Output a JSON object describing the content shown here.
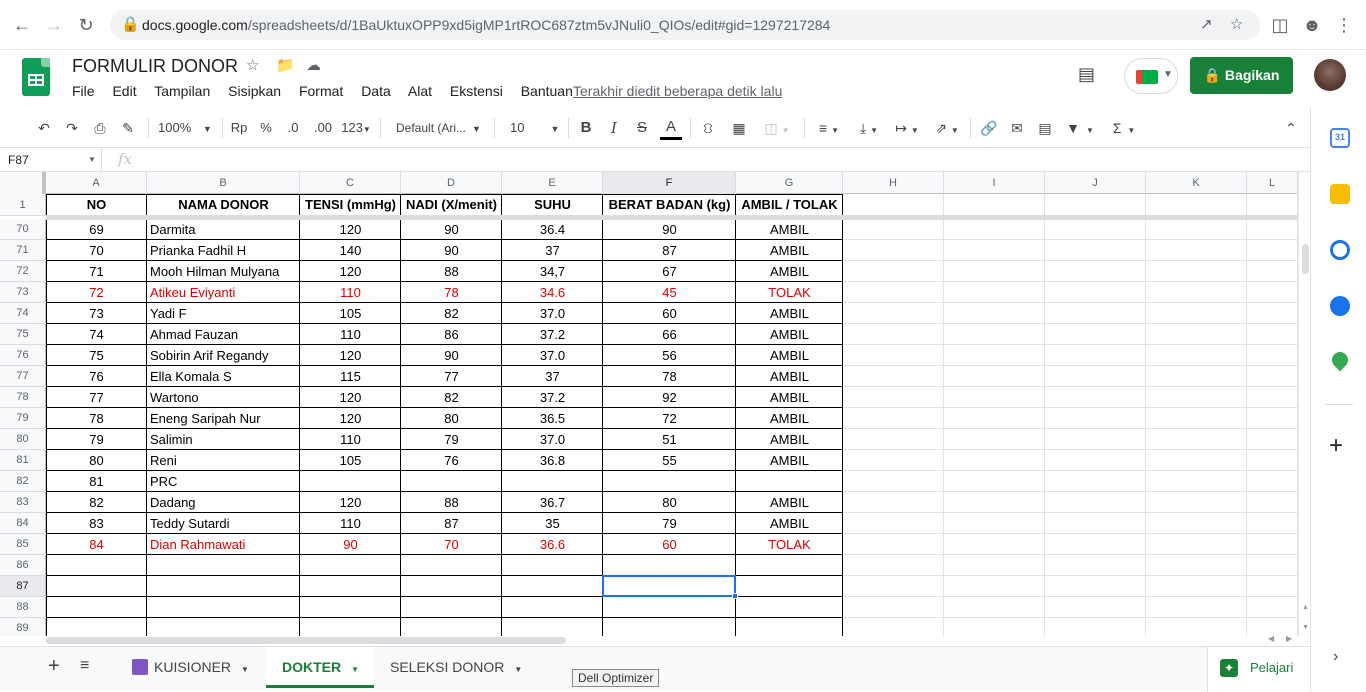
{
  "browser": {
    "url_host": "docs.google.com",
    "url_path": "/spreadsheets/d/1BaUktuxOPP9xd5igMP1rtROC687ztm5vJNuli0_QIOs/edit#gid=1297217284"
  },
  "doc": {
    "title": "FORMULIR DONOR",
    "menus": [
      "File",
      "Edit",
      "Tampilan",
      "Sisipkan",
      "Format",
      "Data",
      "Alat",
      "Ekstensi",
      "Bantuan"
    ],
    "last_edit": "Terakhir diedit beberapa detik lalu",
    "share_label": "Bagikan"
  },
  "toolbar": {
    "zoom": "100%",
    "currency": "Rp",
    "percent": "%",
    "dec_decrease": ".0",
    "dec_increase": ".00",
    "more_formats": "123",
    "font": "Default (Ari...",
    "font_size": "10",
    "bold": "B",
    "italic": "I",
    "strike": "S",
    "text_color": "A"
  },
  "formula": {
    "namebox": "F87",
    "fx": "fx"
  },
  "columns": [
    "A",
    "B",
    "C",
    "D",
    "E",
    "F",
    "G",
    "H",
    "I",
    "J",
    "K",
    "L"
  ],
  "header_row": {
    "row_number": "1",
    "cells": [
      "NO",
      "NAMA DONOR",
      "TENSI (mmHg)",
      "NADI (X/menit)",
      "SUHU",
      "BERAT BADAN (kg)",
      "AMBIL / TOLAK"
    ]
  },
  "rows": [
    {
      "n": "70",
      "cells": [
        "69",
        "Darmita",
        "120",
        "90",
        "36.4",
        "90",
        "AMBIL"
      ],
      "red": false
    },
    {
      "n": "71",
      "cells": [
        "70",
        "Prianka Fadhil H",
        "140",
        "90",
        "37",
        "87",
        "AMBIL"
      ],
      "red": false
    },
    {
      "n": "72",
      "cells": [
        "71",
        "Mooh Hilman Mulyana",
        "120",
        "88",
        "34,7",
        "67",
        "AMBIL"
      ],
      "red": false
    },
    {
      "n": "73",
      "cells": [
        "72",
        "Atikeu Eviyanti",
        "110",
        "78",
        "34.6",
        "45",
        "TOLAK"
      ],
      "red": true
    },
    {
      "n": "74",
      "cells": [
        "73",
        "Yadi F",
        "105",
        "82",
        "37.0",
        "60",
        "AMBIL"
      ],
      "red": false
    },
    {
      "n": "75",
      "cells": [
        "74",
        "Ahmad Fauzan",
        "110",
        "86",
        "37.2",
        "66",
        "AMBIL"
      ],
      "red": false
    },
    {
      "n": "76",
      "cells": [
        "75",
        "Sobirin Arif Regandy",
        "120",
        "90",
        "37.0",
        "56",
        "AMBIL"
      ],
      "red": false
    },
    {
      "n": "77",
      "cells": [
        "76",
        "Ella Komala S",
        "115",
        "77",
        "37",
        "78",
        "AMBIL"
      ],
      "red": false
    },
    {
      "n": "78",
      "cells": [
        "77",
        "Wartono",
        "120",
        "82",
        "37.2",
        "92",
        "AMBIL"
      ],
      "red": false
    },
    {
      "n": "79",
      "cells": [
        "78",
        "Eneng Saripah Nur",
        "120",
        "80",
        "36.5",
        "72",
        "AMBIL"
      ],
      "red": false
    },
    {
      "n": "80",
      "cells": [
        "79",
        "Salimin",
        "110",
        "79",
        "37.0",
        "51",
        "AMBIL"
      ],
      "red": false
    },
    {
      "n": "81",
      "cells": [
        "80",
        "Reni",
        "105",
        "76",
        "36.8",
        "55",
        "AMBIL"
      ],
      "red": false
    },
    {
      "n": "82",
      "cells": [
        "81",
        "PRC",
        "",
        "",
        "",
        "",
        ""
      ],
      "red": false
    },
    {
      "n": "83",
      "cells": [
        "82",
        "Dadang",
        "120",
        "88",
        "36.7",
        "80",
        "AMBIL"
      ],
      "red": false
    },
    {
      "n": "84",
      "cells": [
        "83",
        "Teddy Sutardi",
        "110",
        "87",
        "35",
        "79",
        "AMBIL"
      ],
      "red": false
    },
    {
      "n": "85",
      "cells": [
        "84",
        "Dian Rahmawati",
        "90",
        "70",
        "36.6",
        "60",
        "TOLAK"
      ],
      "red": true
    },
    {
      "n": "86",
      "cells": [
        "",
        "",
        "",
        "",
        "",
        "",
        ""
      ],
      "red": false
    },
    {
      "n": "87",
      "cells": [
        "",
        "",
        "",
        "",
        "",
        "",
        ""
      ],
      "red": false
    },
    {
      "n": "88",
      "cells": [
        "",
        "",
        "",
        "",
        "",
        "",
        ""
      ],
      "red": false
    },
    {
      "n": "89",
      "cells": [
        "",
        "",
        "",
        "",
        "",
        "",
        ""
      ],
      "red": false
    }
  ],
  "selected": {
    "column": "F",
    "row": "87"
  },
  "sheets": {
    "tabs": [
      "KUISIONER",
      "DOKTER",
      "SELEKSI DONOR"
    ],
    "active": "DOKTER",
    "learn_label": "Pelajari"
  },
  "tooltip": "Dell Optimizer",
  "colors": {
    "sheets_green": "#188038",
    "selection_blue": "#1a73e8",
    "reject_red": "#e00000"
  }
}
